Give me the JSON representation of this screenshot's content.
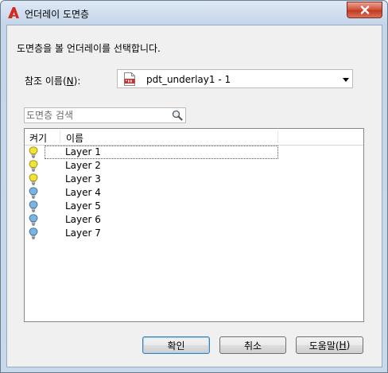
{
  "window": {
    "title": "언더레이 도면층"
  },
  "instruction": "도면층을 볼 언더레이를 선택합니다.",
  "reference": {
    "label_pre": "참조 이름(",
    "label_key": "N",
    "label_post": "):",
    "value": "pdt_underlay1 - 1"
  },
  "search": {
    "placeholder": "도면층 검색"
  },
  "table": {
    "headers": {
      "on": "켜기",
      "name": "이름"
    },
    "rows": [
      {
        "name": "Layer 1",
        "state": "on"
      },
      {
        "name": "Layer 2",
        "state": "on"
      },
      {
        "name": "Layer 3",
        "state": "on"
      },
      {
        "name": "Layer 4",
        "state": "off"
      },
      {
        "name": "Layer 5",
        "state": "off"
      },
      {
        "name": "Layer 6",
        "state": "off"
      },
      {
        "name": "Layer 7",
        "state": "off"
      }
    ]
  },
  "buttons": {
    "ok": "확인",
    "cancel": "취소",
    "help_pre": "도움말(",
    "help_key": "H",
    "help_post": ")"
  },
  "colors": {
    "bulb_on": "#f2e33a",
    "bulb_off": "#7ab4e0",
    "accent": "#3c7fb1",
    "close": "#c23b22"
  },
  "icons": {
    "app": "autocad-logo-icon",
    "file": "pdf-file-icon",
    "search": "magnifier-icon"
  }
}
